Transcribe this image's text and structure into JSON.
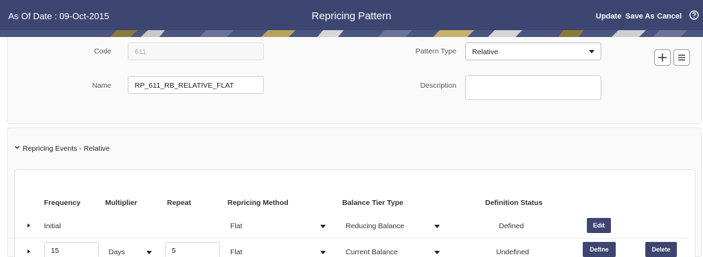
{
  "header": {
    "as_of_date": "As Of Date : 09-Oct-2015",
    "title": "Repricing Pattern",
    "actions": {
      "update": "Update",
      "save_as": "Save As",
      "cancel": "Cancel"
    },
    "help_icon": "help-circle-icon"
  },
  "form": {
    "code": {
      "label": "Code",
      "value": "611"
    },
    "name": {
      "label": "Name",
      "value": "RP_611_RB_RELATIVE_FLAT"
    },
    "pattern_type": {
      "label": "Pattern Type",
      "value": "Relative"
    },
    "description": {
      "label": "Description",
      "value": ""
    }
  },
  "events": {
    "section_title": "Repricing Events -  Relative",
    "columns": [
      "Frequency",
      "Multiplier",
      "Repeat",
      "Repricing Method",
      "Balance Tier Type",
      "Definition Status"
    ],
    "rows": [
      {
        "frequency": "Initial",
        "multiplier": "",
        "repeat": "",
        "repricing_method": "Flat",
        "balance_tier_type": "Reducing Balance",
        "definition_status": "Defined",
        "primary_action": "Edit"
      },
      {
        "frequency": "15",
        "multiplier": "Days",
        "repeat": "5",
        "repricing_method": "Flat",
        "balance_tier_type": "Current Balance",
        "definition_status": "Undefined",
        "primary_action": "Define",
        "secondary_action": "Delete"
      }
    ],
    "toolbar": {
      "add_icon": "plus-icon",
      "columns_icon": "list-icon"
    }
  },
  "colors": {
    "header_bg": "#3d4670",
    "button_bg": "#3d4670"
  }
}
